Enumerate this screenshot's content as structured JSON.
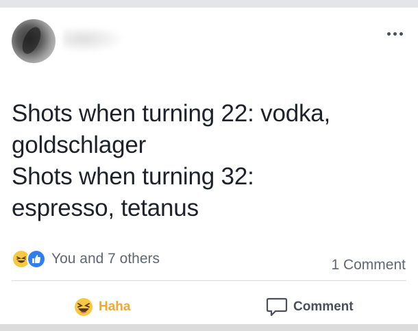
{
  "post": {
    "lines": [
      "Shots when turning 22: vodka,",
      "goldschlager",
      "Shots when turning 32:",
      "espresso, tetanus"
    ]
  },
  "reactions": {
    "summary": "You and 7 others",
    "comment_count": "1 Comment",
    "icons": [
      "haha-face",
      "thumbs-up"
    ]
  },
  "actions": {
    "haha_label": "Haha",
    "comment_label": "Comment"
  },
  "colors": {
    "haha": "#f0a92e",
    "like": "#2f7ff0",
    "text": "#1d2129",
    "muted": "#606770"
  }
}
